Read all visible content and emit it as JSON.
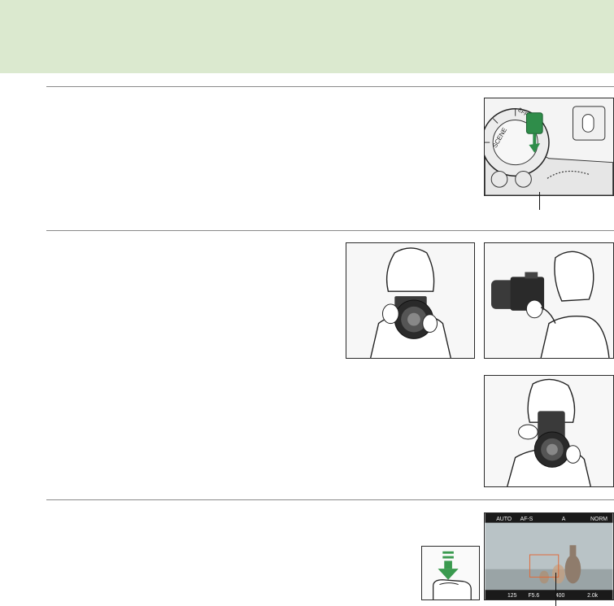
{
  "page": {
    "colors": {
      "header_band": "#dbe9cf",
      "rule": "#8a8a8a",
      "shutter_arrow": "#3a9a4f",
      "flash_button": "#2f8d4a",
      "viewfinder_bar": "#1a1a1a",
      "viewfinder_text": "#f2f2f2",
      "viewfinder_accent": "#e06a3a"
    }
  },
  "figures": {
    "mode_dial": {
      "icon": "mode-dial-icon",
      "dial_labels": [
        "SCENE",
        "EFFECTS"
      ]
    },
    "holding_front": {
      "icon": "person-holding-camera-icon"
    },
    "holding_side": {
      "icon": "person-holding-camera-icon"
    },
    "holding_portrait": {
      "icon": "person-holding-camera-icon"
    },
    "shutter": {
      "icon": "shutter-press-icon"
    },
    "viewfinder": {
      "icon": "viewfinder-display-icon",
      "top_items": [
        "AUTO",
        "AF-S",
        "A",
        "NORM"
      ],
      "bottom_items": [
        "125",
        "F5.6",
        "400",
        "2.0k"
      ]
    }
  }
}
